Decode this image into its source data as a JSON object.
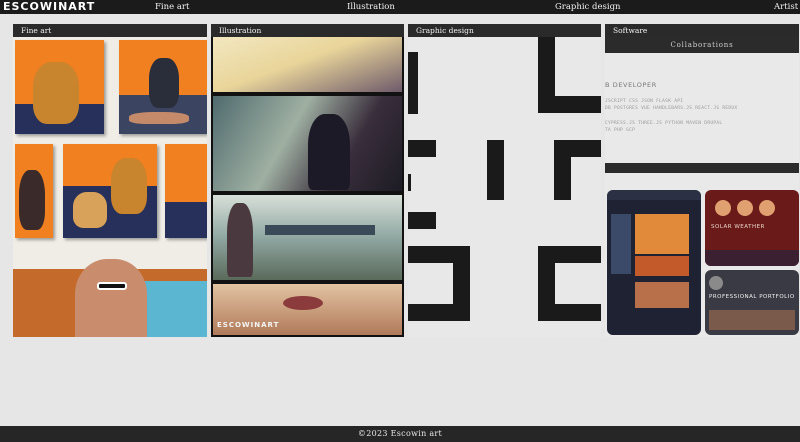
{
  "nav": {
    "logo": "ESCOWINART",
    "links": [
      "Fine art",
      "Illustration",
      "Graphic design",
      "Artist"
    ]
  },
  "panels": [
    {
      "title": "Fine art"
    },
    {
      "title": "Illustration"
    },
    {
      "title": "Graphic design"
    },
    {
      "title": "Software"
    }
  ],
  "software": {
    "collaborations": "Collaborations",
    "role": "B DEVELOPER",
    "stack_line_1": "JSCRIPT   CSS   JSON   FLASK   API",
    "stack_line_2": "DB   POSTGRES   VUE   HANDLEBARS.JS   REACT.JS   REDUX",
    "stack_line_3": "CYPRESS.JS   THREE.JS   PYTHON   MAVEN   DRUPAL",
    "stack_line_4": "TA   PHP   GCP",
    "card_solar": "SOLAR WEATHER",
    "card_portfolio": "PROFESSIONAL PORTFOLIO"
  },
  "illustration": {
    "signature": "ESCOWINART"
  },
  "footer": {
    "text": "©2023 Escowin art"
  },
  "colors": {
    "nav_bg": "#1b1b1b",
    "panel_header": "#2a2a2a",
    "page_bg": "#e6e6e6",
    "accent_orange": "#f08020",
    "accent_navy": "#27305a"
  }
}
